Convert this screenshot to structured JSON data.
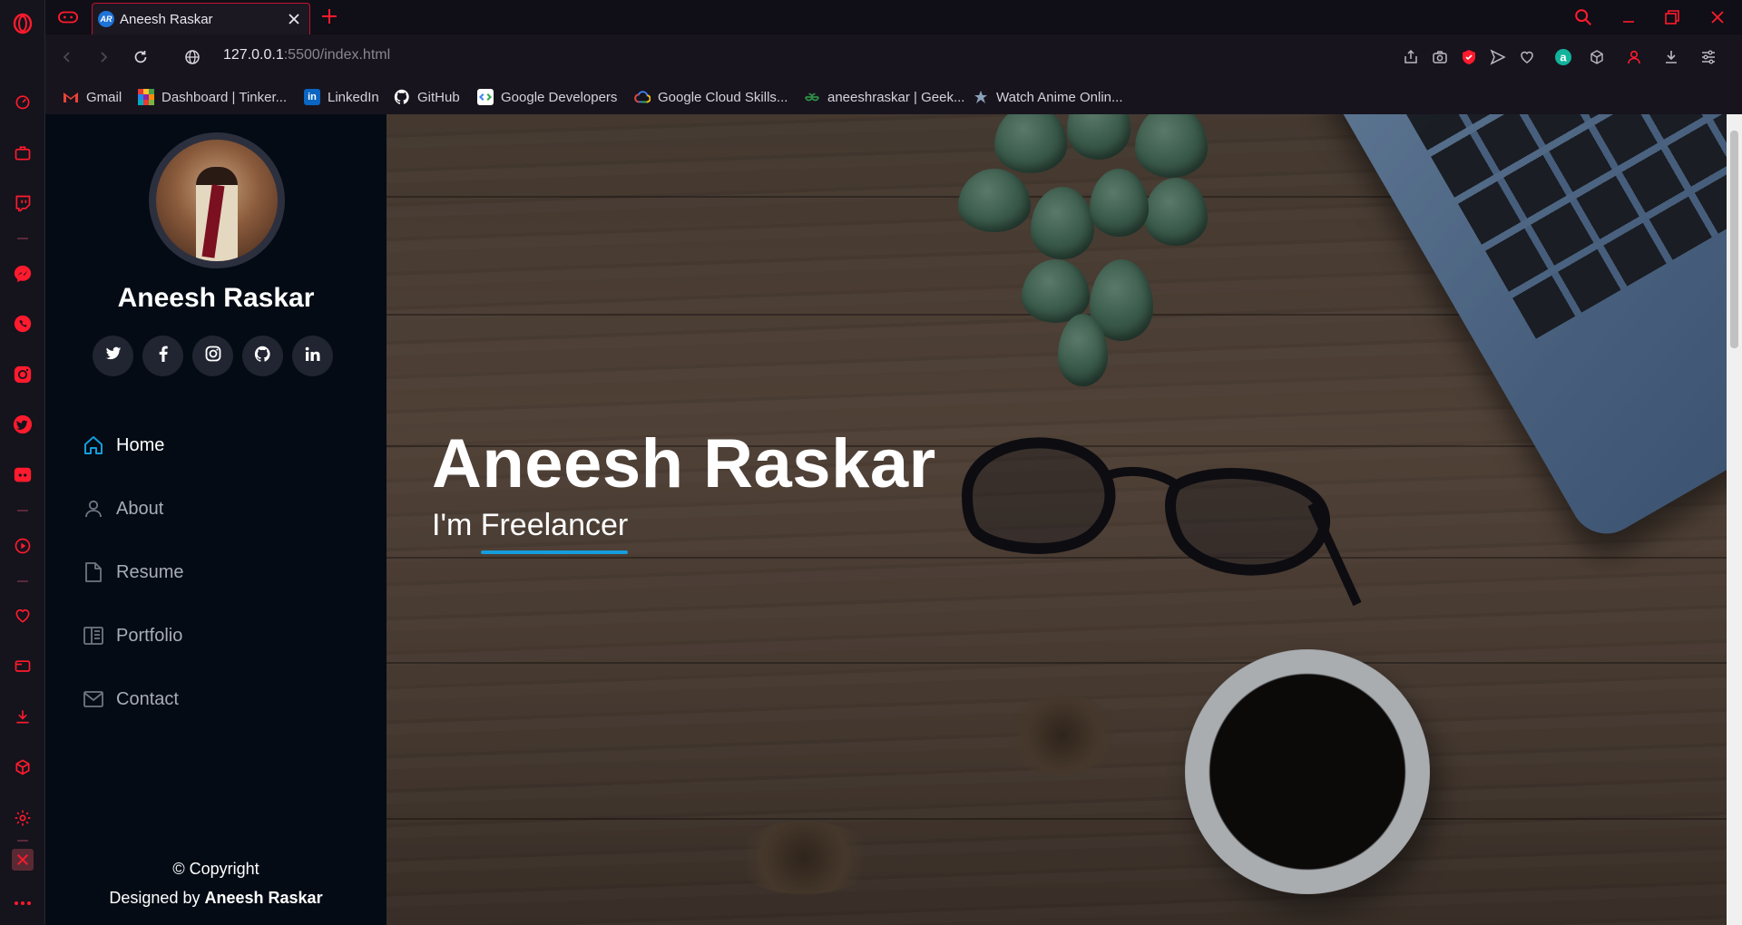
{
  "browser": {
    "tab": {
      "title": "Aneesh Raskar",
      "favicon_text": "AR"
    },
    "url": {
      "host": "127.0.0.1",
      "rest": ":5500/index.html"
    },
    "bookmarks": [
      {
        "label": "Gmail",
        "icon": "gmail-icon",
        "color": "#ea4335"
      },
      {
        "label": "Dashboard | Tinker...",
        "icon": "tinkercad-icon",
        "color": "#f5a623"
      },
      {
        "label": "LinkedIn",
        "icon": "linkedin-icon",
        "color": "#0a66c2"
      },
      {
        "label": "GitHub",
        "icon": "github-icon",
        "color": "#ffffff"
      },
      {
        "label": "Google Developers",
        "icon": "google-developers-icon",
        "color": "#4285f4"
      },
      {
        "label": "Google Cloud Skills...",
        "icon": "google-cloud-icon",
        "color": "#fbbc04"
      },
      {
        "label": "aneeshraskar | Geek...",
        "icon": "geeksforgeeks-icon",
        "color": "#2f8d46"
      },
      {
        "label": "Watch Anime Onlin...",
        "icon": "anime-site-icon",
        "color": "#8aa0b8"
      }
    ]
  },
  "sidebar": {
    "name": "Aneesh Raskar",
    "social": [
      "twitter-icon",
      "facebook-icon",
      "instagram-icon",
      "github-icon",
      "linkedin-icon"
    ],
    "menu": [
      {
        "label": "Home",
        "icon": "home-icon",
        "active": true
      },
      {
        "label": "About",
        "icon": "person-icon",
        "active": false
      },
      {
        "label": "Resume",
        "icon": "file-icon",
        "active": false
      },
      {
        "label": "Portfolio",
        "icon": "book-half-icon",
        "active": false
      },
      {
        "label": "Contact",
        "icon": "envelope-icon",
        "active": false
      }
    ],
    "footer": {
      "copyright": "© Copyright",
      "designed_by": "Designed by",
      "designer": "Aneesh Raskar"
    }
  },
  "hero": {
    "title": "Aneesh Raskar",
    "prefix": "I'm",
    "typed": "Freelancer"
  },
  "colors": {
    "accent": "#149ddd",
    "opera_red": "#ff1b2d",
    "sidebar_bg": "#040b14"
  }
}
